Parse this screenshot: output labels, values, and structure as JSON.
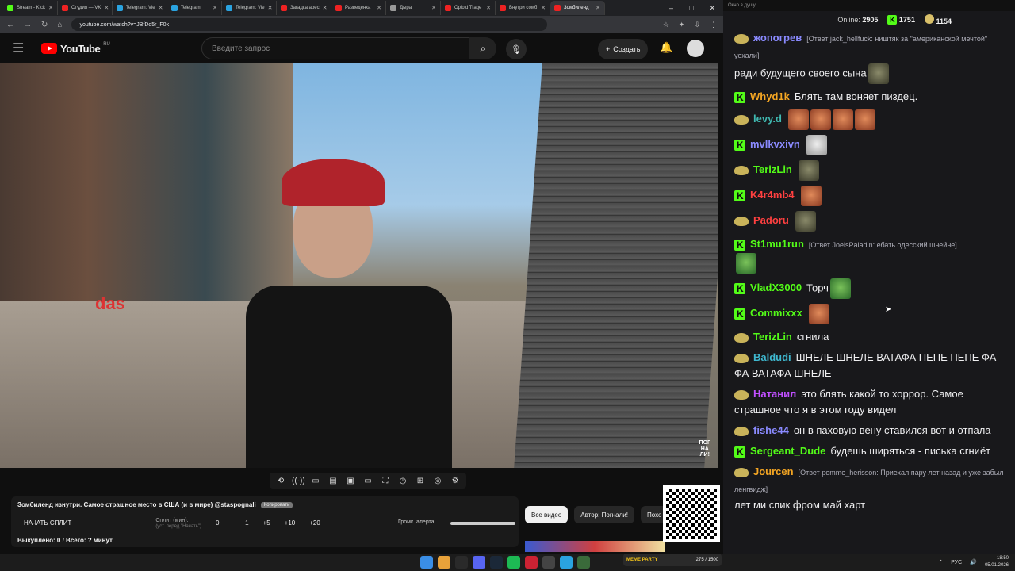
{
  "browser": {
    "tabs": [
      {
        "title": "Stream - Kick",
        "color": "#53fc18"
      },
      {
        "title": "Студия — VK",
        "color": "#e22"
      },
      {
        "title": "Telegram: Vie",
        "color": "#2aa3e0"
      },
      {
        "title": "Telegram",
        "color": "#2aa3e0"
      },
      {
        "title": "Telegram: Vie",
        "color": "#2aa3e0"
      },
      {
        "title": "Загадка арес",
        "color": "#e22"
      },
      {
        "title": "Разведенка",
        "color": "#e22"
      },
      {
        "title": "Дыра",
        "color": "#999"
      },
      {
        "title": "Opioid Trage",
        "color": "#e22"
      },
      {
        "title": "Внутри сомб",
        "color": "#e22"
      },
      {
        "title": "Зомбиленд",
        "color": "#e22",
        "active": true
      }
    ],
    "url": "youtube.com/watch?v=JBfDo5r_F0k"
  },
  "youtube": {
    "logo_text": "YouTube",
    "region": "RU",
    "search_placeholder": "Введите запрос",
    "create_label": "Создать"
  },
  "video": {
    "watermark_line1": "ПОГ",
    "watermark_line2": "НА",
    "watermark_line3": "ЛИ!",
    "shirt_text": "das"
  },
  "panel": {
    "title": "Зомбиленд изнутри. Самое страшное место в США (и в мире) @staspognali",
    "copy_label": "Копировать",
    "start_split": "НАЧАТЬ СПЛИТ",
    "split_label": "Сплит (мин):",
    "split_sub": "(уст. перед \"Начать\")",
    "split_value": "0",
    "steps": [
      "+1",
      "+5",
      "+10",
      "+20"
    ],
    "alert_label": "Громк. алерта:",
    "bought": "Выкуплено: 0 / Всего: ? минут"
  },
  "filters": [
    "Все видео",
    "Автор: Погнали!",
    "Похо"
  ],
  "chat": {
    "window_title": "Окно в душу",
    "online_label": "Online:",
    "online_value": "2905",
    "kick_count": "1751",
    "coin_count": "1154",
    "messages": [
      {
        "badge": "pepe",
        "user": "жопогрев",
        "color": "#8a8aff",
        "reply": "[Ответ jack_hellfuck: ништяк за \"американской мечтой\" уехали]",
        "text": "ради будущего своего сына",
        "emotes": [
          "rock"
        ]
      },
      {
        "badge": "k",
        "user": "Whyd1k",
        "color": "#f5a623",
        "reply": "",
        "text": "Блять там воняет пиздец.",
        "emotes": []
      },
      {
        "badge": "pepe",
        "user": "levy.d",
        "color": "#3fb8b0",
        "reply": "",
        "text": "",
        "emotes": [
          "face",
          "face",
          "face",
          "face"
        ]
      },
      {
        "badge": "k",
        "user": "mvlkvxivn",
        "color": "#8a8aff",
        "reply": "",
        "text": "",
        "emotes": [
          "cat"
        ]
      },
      {
        "badge": "pepe",
        "user": "TerizLin",
        "color": "#53fc18",
        "reply": "",
        "text": "",
        "emotes": [
          "rock"
        ]
      },
      {
        "badge": "k",
        "user": "K4r4mb4",
        "color": "#ff4040",
        "reply": "",
        "text": "",
        "emotes": [
          "face"
        ]
      },
      {
        "badge": "pepe",
        "user": "Padoru",
        "color": "#ff4040",
        "reply": "",
        "text": "",
        "emotes": [
          "rock"
        ]
      },
      {
        "badge": "k",
        "user": "St1mu1run",
        "color": "#53fc18",
        "reply": "[Ответ JoeisPaladin: ебать одесский шнейне]",
        "text": "",
        "emotes": [
          "frog"
        ]
      },
      {
        "badge": "k",
        "user": "VladX3000",
        "color": "#53fc18",
        "reply": "",
        "text": "Торч",
        "emotes": [
          "frog"
        ]
      },
      {
        "badge": "k",
        "user": "Commixxx",
        "color": "#53fc18",
        "reply": "",
        "text": "",
        "emotes": [
          "face"
        ]
      },
      {
        "badge": "pepe",
        "user": "TerizLin",
        "color": "#53fc18",
        "reply": "",
        "text": "сгнила",
        "emotes": []
      },
      {
        "badge": "pepe",
        "user": "Baldudi",
        "color": "#3fb8d0",
        "reply": "",
        "text": "ШНЕЛЕ ШНЕЛЕ ВАТАФА ПЕПЕ ПЕПЕ ФА ФА ВАТАФА ШНЕЛЕ",
        "emotes": []
      },
      {
        "badge": "pepe",
        "user": "Натанил",
        "color": "#c04fff",
        "reply": "",
        "text": "это блять какой то хоррор. Самое страшное что я в этом году видел",
        "emotes": []
      },
      {
        "badge": "pepe",
        "user": "fishe44",
        "color": "#8a8aff",
        "reply": "",
        "text": "он в паховую вену ставился вот и отпала",
        "emotes": []
      },
      {
        "badge": "k",
        "user": "Sergeant_Dude",
        "color": "#53fc18",
        "reply": "",
        "text": "будешь ширяться - писька сгниёт",
        "emotes": []
      },
      {
        "badge": "pepe",
        "user": "Jourcen",
        "color": "#f5a623",
        "reply": "[Ответ pomme_herisson: Приехал пару лет назад и уже забыл ленгвидж]",
        "text": "лет ми спик фром май харт",
        "emotes": []
      }
    ]
  },
  "taskbar": {
    "meme_label": "MEME PARTY",
    "meme_progress": "275 / 1500",
    "lang": "РУС",
    "time": "18:50",
    "date": "05.01.2026"
  }
}
